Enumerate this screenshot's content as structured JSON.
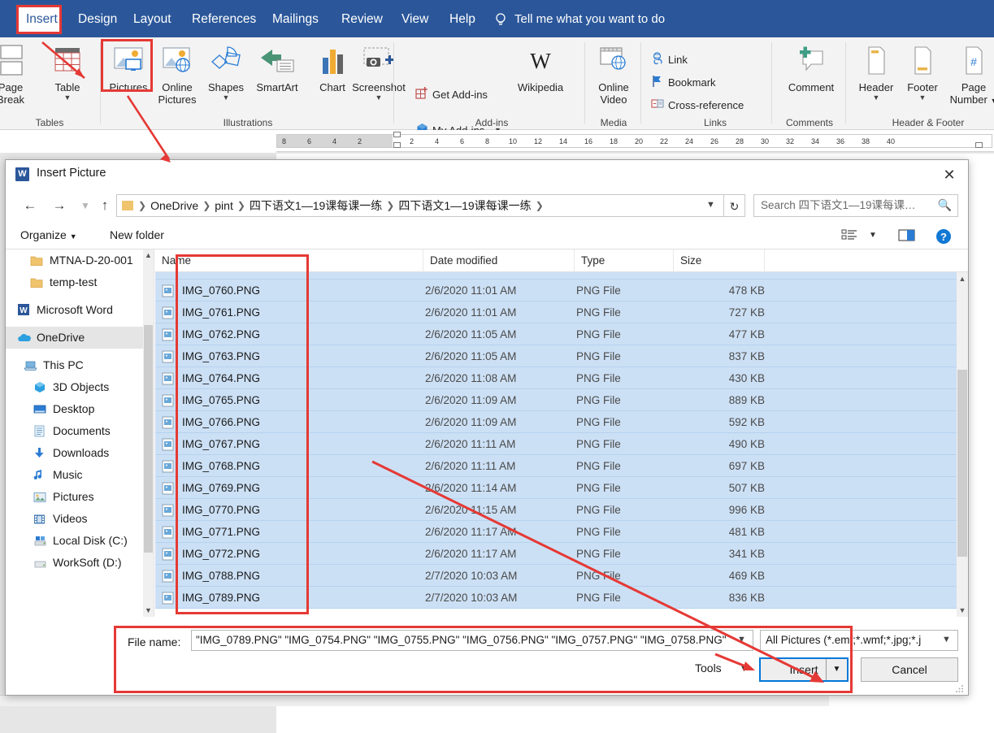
{
  "ribbon": {
    "tabs": [
      {
        "label": "Insert",
        "active": true
      },
      {
        "label": "Design",
        "active": false
      },
      {
        "label": "Layout",
        "active": false
      },
      {
        "label": "References",
        "active": false
      },
      {
        "label": "Mailings",
        "active": false
      },
      {
        "label": "Review",
        "active": false
      },
      {
        "label": "View",
        "active": false
      },
      {
        "label": "Help",
        "active": false
      }
    ],
    "tellme": "Tell me what you want to do",
    "groups": [
      {
        "label": "Tables"
      },
      {
        "label": "Illustrations"
      },
      {
        "label": "Add-ins"
      },
      {
        "label": "Media"
      },
      {
        "label": "Links"
      },
      {
        "label": "Comments"
      },
      {
        "label": "Header & Footer"
      }
    ],
    "buttons": {
      "page_break_l1": "Page",
      "page_break_l2": "Break",
      "table": "Table",
      "pictures": "Pictures",
      "online_l1": "Online",
      "online_l2": "Pictures",
      "shapes": "Shapes",
      "smartart": "SmartArt",
      "chart": "Chart",
      "screenshot": "Screenshot",
      "get_addins": "Get Add-ins",
      "my_addins": "My Add-ins",
      "wikipedia": "Wikipedia",
      "online_video_l1": "Online",
      "online_video_l2": "Video",
      "link": "Link",
      "bookmark": "Bookmark",
      "cross_reference": "Cross-reference",
      "comment": "Comment",
      "header": "Header",
      "footer": "Footer",
      "page_number_l1": "Page",
      "page_number_l2": "Number"
    }
  },
  "ruler": {
    "ticks": [
      "8",
      "6",
      "4",
      "2",
      "",
      "2",
      "4",
      "6",
      "8",
      "10",
      "12",
      "14",
      "16",
      "18",
      "20",
      "22",
      "24",
      "26",
      "28",
      "30",
      "32",
      "34",
      "36",
      "38",
      "40"
    ]
  },
  "dialog": {
    "title": "Insert Picture",
    "close_label": "✕",
    "breadcrumbs": [
      "OneDrive",
      "pint",
      "四下语文1—19课每课一练",
      "四下语文1—19课每课一练"
    ],
    "search_placeholder": "Search 四下语文1—19课每课…",
    "commands": {
      "organize": "Organize",
      "new_folder": "New folder",
      "help": "?"
    },
    "nav_items": [
      {
        "label": "MTNA-D-20-001",
        "icon": "folder-icon",
        "selected": false,
        "indent": 30
      },
      {
        "label": "temp-test",
        "icon": "folder-icon",
        "selected": false,
        "indent": 30
      },
      {
        "label": "Microsoft Word",
        "icon": "word-icon",
        "selected": false,
        "indent": 14
      },
      {
        "label": "OneDrive",
        "icon": "cloud-icon",
        "selected": true,
        "indent": 14
      },
      {
        "label": "This PC",
        "icon": "pc-icon",
        "selected": false,
        "indent": 22
      },
      {
        "label": "3D Objects",
        "icon": "cube-icon",
        "selected": false,
        "indent": 34
      },
      {
        "label": "Desktop",
        "icon": "desktop-icon",
        "selected": false,
        "indent": 34
      },
      {
        "label": "Documents",
        "icon": "documents-icon",
        "selected": false,
        "indent": 34
      },
      {
        "label": "Downloads",
        "icon": "downloads-icon",
        "selected": false,
        "indent": 34
      },
      {
        "label": "Music",
        "icon": "music-icon",
        "selected": false,
        "indent": 34
      },
      {
        "label": "Pictures",
        "icon": "pictures-icon",
        "selected": false,
        "indent": 34
      },
      {
        "label": "Videos",
        "icon": "videos-icon",
        "selected": false,
        "indent": 34
      },
      {
        "label": "Local Disk (C:)",
        "icon": "disk-c-icon",
        "selected": false,
        "indent": 34
      },
      {
        "label": "WorkSoft (D:)",
        "icon": "disk-d-icon",
        "selected": false,
        "indent": 34
      }
    ],
    "columns": [
      "Name",
      "Date modified",
      "Type",
      "Size"
    ],
    "files": [
      {
        "name": "IMG_0760.PNG",
        "date": "2/6/2020 11:01 AM",
        "type": "PNG File",
        "size": "478 KB"
      },
      {
        "name": "IMG_0761.PNG",
        "date": "2/6/2020 11:01 AM",
        "type": "PNG File",
        "size": "727 KB"
      },
      {
        "name": "IMG_0762.PNG",
        "date": "2/6/2020 11:05 AM",
        "type": "PNG File",
        "size": "477 KB"
      },
      {
        "name": "IMG_0763.PNG",
        "date": "2/6/2020 11:05 AM",
        "type": "PNG File",
        "size": "837 KB"
      },
      {
        "name": "IMG_0764.PNG",
        "date": "2/6/2020 11:08 AM",
        "type": "PNG File",
        "size": "430 KB"
      },
      {
        "name": "IMG_0765.PNG",
        "date": "2/6/2020 11:09 AM",
        "type": "PNG File",
        "size": "889 KB"
      },
      {
        "name": "IMG_0766.PNG",
        "date": "2/6/2020 11:09 AM",
        "type": "PNG File",
        "size": "592 KB"
      },
      {
        "name": "IMG_0767.PNG",
        "date": "2/6/2020 11:11 AM",
        "type": "PNG File",
        "size": "490 KB"
      },
      {
        "name": "IMG_0768.PNG",
        "date": "2/6/2020 11:11 AM",
        "type": "PNG File",
        "size": "697 KB"
      },
      {
        "name": "IMG_0769.PNG",
        "date": "2/6/2020 11:14 AM",
        "type": "PNG File",
        "size": "507 KB"
      },
      {
        "name": "IMG_0770.PNG",
        "date": "2/6/2020 11:15 AM",
        "type": "PNG File",
        "size": "996 KB"
      },
      {
        "name": "IMG_0771.PNG",
        "date": "2/6/2020 11:17 AM",
        "type": "PNG File",
        "size": "481 KB"
      },
      {
        "name": "IMG_0772.PNG",
        "date": "2/6/2020 11:17 AM",
        "type": "PNG File",
        "size": "341 KB"
      },
      {
        "name": "IMG_0788.PNG",
        "date": "2/7/2020 10:03 AM",
        "type": "PNG File",
        "size": "469 KB"
      },
      {
        "name": "IMG_0789.PNG",
        "date": "2/7/2020 10:03 AM",
        "type": "PNG File",
        "size": "836 KB"
      }
    ],
    "footer": {
      "file_name_label": "File name:",
      "file_name_value": "\"IMG_0789.PNG\" \"IMG_0754.PNG\" \"IMG_0755.PNG\" \"IMG_0756.PNG\" \"IMG_0757.PNG\" \"IMG_0758.PNG\"",
      "filter_value": "All Pictures (*.emf;*.wmf;*.jpg;*.j",
      "tools_label": "Tools",
      "insert_label": "Insert",
      "cancel_label": "Cancel"
    }
  },
  "colors": {
    "word_blue": "#2b579a",
    "annotation_red": "#e53935",
    "selection_blue": "#cce0f5",
    "focus_blue": "#0078d7"
  }
}
